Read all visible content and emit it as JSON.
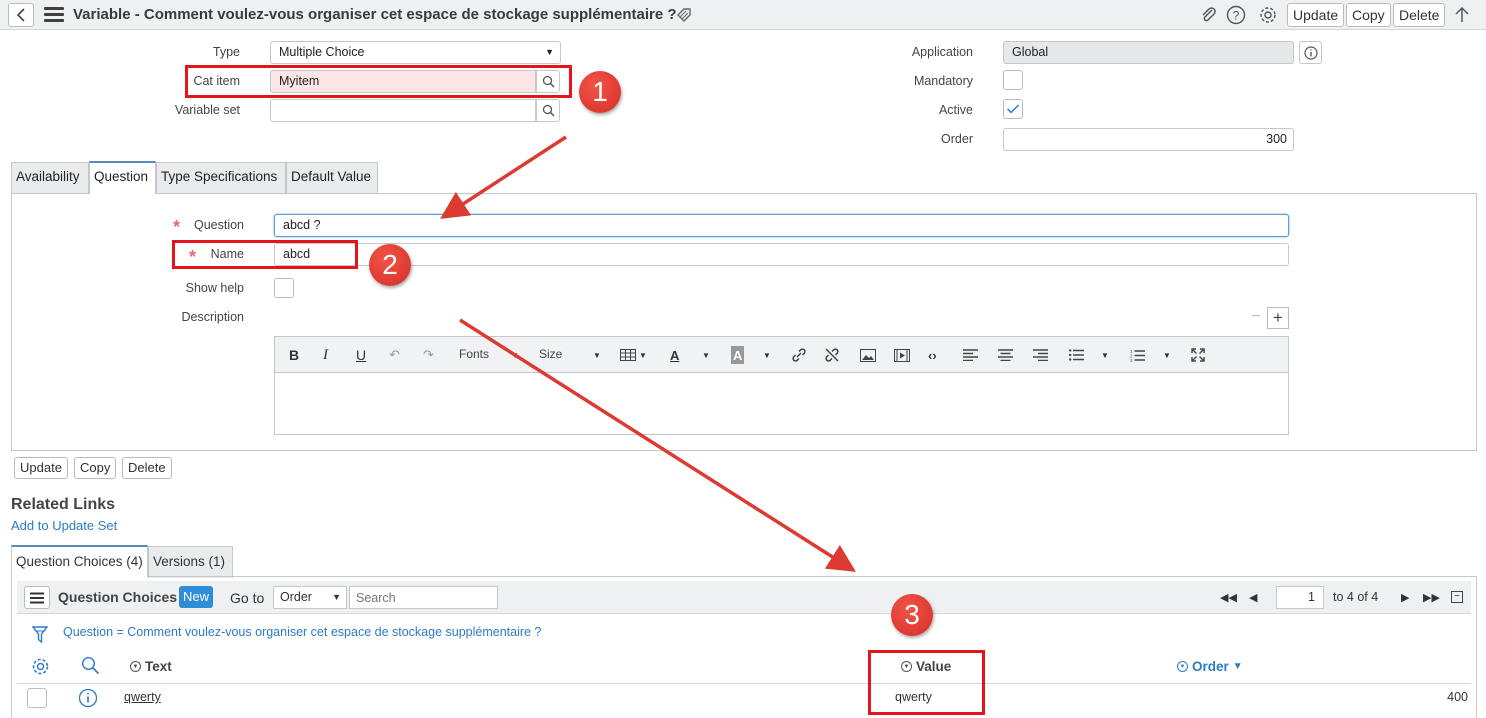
{
  "header": {
    "title": "Variable - Comment voulez-vous organiser cet espace de stockage supplémentaire ?",
    "buttons": {
      "update": "Update",
      "copy": "Copy",
      "delete": "Delete"
    }
  },
  "form": {
    "type": {
      "label": "Type",
      "value": "Multiple Choice"
    },
    "cat_item": {
      "label": "Cat item",
      "value": "Myitem"
    },
    "variable_set": {
      "label": "Variable set",
      "value": ""
    },
    "application": {
      "label": "Application",
      "value": "Global"
    },
    "mandatory": {
      "label": "Mandatory",
      "checked": false
    },
    "active": {
      "label": "Active",
      "checked": true
    },
    "order": {
      "label": "Order",
      "value": "300"
    }
  },
  "tabs": [
    {
      "label": "Availability"
    },
    {
      "label": "Question",
      "active": true
    },
    {
      "label": "Type Specifications"
    },
    {
      "label": "Default Value"
    }
  ],
  "question_tab": {
    "question": {
      "label": "Question",
      "value": "abcd ?"
    },
    "name": {
      "label": "Name",
      "value": "abcd"
    },
    "show_help": {
      "label": "Show help"
    },
    "description": {
      "label": "Description"
    },
    "editor": {
      "fonts": "Fonts",
      "size": "Size"
    }
  },
  "bottom_buttons": {
    "update": "Update",
    "copy": "Copy",
    "delete": "Delete"
  },
  "related": {
    "title": "Related Links",
    "add_to_update_set": "Add to Update Set",
    "tabs": [
      {
        "label": "Question Choices (4)",
        "active": true
      },
      {
        "label": "Versions (1)"
      }
    ]
  },
  "list": {
    "title": "Question Choices",
    "new_label": "New",
    "goto_label": "Go to",
    "goto_field": "Order",
    "search_placeholder": "Search",
    "page_current": "1",
    "page_text": "to 4 of 4",
    "filter": "Question = Comment voulez-vous organiser cet espace de stockage supplémentaire ?",
    "columns": {
      "text": "Text",
      "value": "Value",
      "order": "Order"
    },
    "rows": [
      {
        "text": "qwerty",
        "value": "qwerty",
        "order": "400"
      }
    ]
  },
  "annotations": {
    "one": "1",
    "two": "2",
    "three": "3"
  },
  "colors": {
    "accent": "#2e8dd8",
    "highlight": "#e3141b",
    "link": "#2c7bc6"
  }
}
